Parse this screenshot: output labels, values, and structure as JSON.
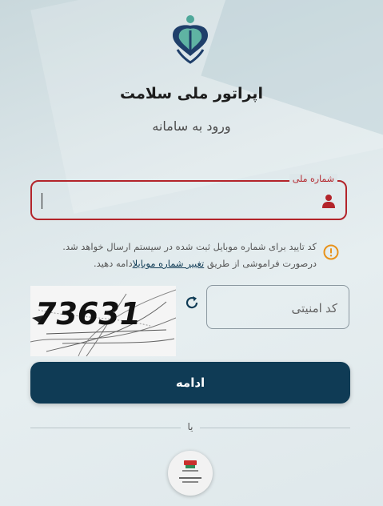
{
  "header": {
    "logo_icon": "health-logo-icon",
    "title": "اپراتور ملی سلامت",
    "subtitle": "ورود به سامانه"
  },
  "national_id": {
    "label": "شماره ملی",
    "value": "",
    "icon": "user-icon",
    "state": "error"
  },
  "notice": {
    "icon": "warning-icon",
    "line1": "کد تایید برای شماره موبایل ثبت شده در سیستم ارسال خواهد شد.",
    "line2_before": "درصورت فراموشی از طریق",
    "link_text": "تغییر شماره موبایل",
    "line2_after": "ادامه دهید."
  },
  "captcha": {
    "image_text": "73631",
    "refresh_icon": "refresh-icon",
    "placeholder": "کد امنیتی",
    "value": ""
  },
  "actions": {
    "continue_label": "ادامه",
    "or_label": "یا",
    "alt_login_icon": "government-services-logo-icon"
  },
  "colors": {
    "primary": "#0f3b55",
    "error": "#b3242a",
    "warning": "#e8921a",
    "logo_top": "#4fa89a",
    "logo_bottom": "#1f3f6a"
  }
}
